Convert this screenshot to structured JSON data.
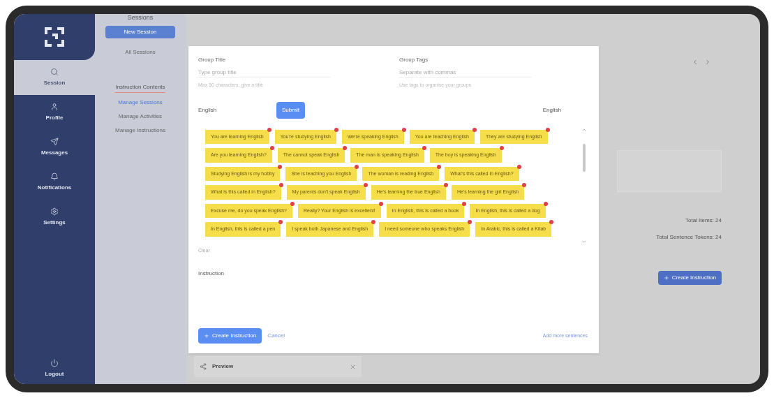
{
  "sidebar": {
    "items": [
      {
        "label": "Session",
        "selected": true
      },
      {
        "label": "Profile",
        "selected": false
      },
      {
        "label": "Messages",
        "selected": false
      },
      {
        "label": "Notifications",
        "selected": false
      },
      {
        "label": "Settings",
        "selected": false
      }
    ],
    "footer": "Logout"
  },
  "subnav": {
    "heading": "Sessions",
    "button": "New Session",
    "date": "All Sessions",
    "section": "Instruction Contents",
    "links": [
      {
        "label": "Manage Sessions",
        "selected": true
      },
      {
        "label": "Manage Activities",
        "selected": false
      },
      {
        "label": "Manage Instructions",
        "selected": false
      }
    ]
  },
  "main": {
    "total_items": "Total Items: 24",
    "total_tokens": "Total Sentence Tokens: 24",
    "create_button": "Create Instruction",
    "bottom_tab": "Preview"
  },
  "modal": {
    "fields": [
      {
        "label": "Group Title",
        "placeholder": "Type group title",
        "hint": "Max 50 characters, give a title"
      },
      {
        "label": "Group Tags",
        "placeholder": "Separate with commas",
        "hint": "Use tags to organise your groups"
      }
    ],
    "source_language": "English",
    "submit": "Submit",
    "target_language": "English",
    "sentences": [
      "You are learning English",
      "You're studying English",
      "We're speaking English",
      "You are teaching English",
      "They are studying English",
      "Are you learning English?",
      "The cannot speak English",
      "The man is speaking English",
      "The boy is speaking English",
      "Studying English is my hobby",
      "She is teaching you English",
      "The woman is reading English",
      "What's this called in English?",
      "What is this called in English?",
      "My parents don't speak English",
      "He's learning the true English",
      "He's learning the girl English",
      "Excuse me, do you speak English?",
      "Really? Your English is excellent!",
      "In English, this is called a book",
      "In English, this is called a dog",
      "In English, this is called a pen",
      "I speak both Japanese and English",
      "I need someone who speaks English",
      "In Arabic, this is called a Kitab"
    ],
    "clear": "Clear",
    "instruction_label": "Instruction",
    "create_button": "Create Instruction",
    "cancel": "Cancel",
    "add_more": "Add more sentences"
  }
}
